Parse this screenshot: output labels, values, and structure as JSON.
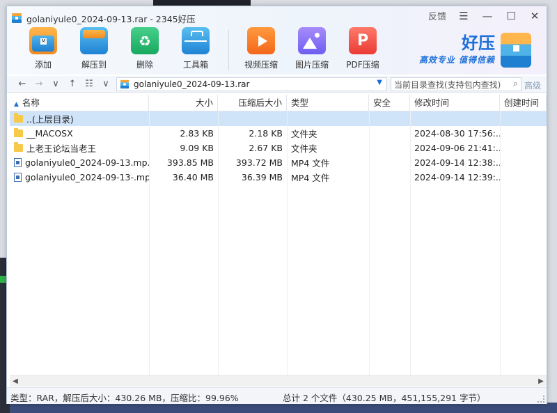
{
  "window": {
    "title": "golaniyule0_2024-09-13.rar - 2345好压",
    "feedback_label": "反馈",
    "menu_icon": "hamburger-icon",
    "minimize_icon": "minimize-icon",
    "maximize_icon": "maximize-icon",
    "close_icon": "close-icon"
  },
  "toolbar": {
    "items": [
      {
        "label": "添加",
        "icon": "add-archive-icon"
      },
      {
        "label": "解压到",
        "icon": "extract-icon"
      },
      {
        "label": "删除",
        "icon": "recycle-delete-icon"
      },
      {
        "label": "工具箱",
        "icon": "toolbox-icon"
      },
      {
        "label": "视频压缩",
        "icon": "video-compress-icon"
      },
      {
        "label": "图片压缩",
        "icon": "image-compress-icon"
      },
      {
        "label": "PDF压缩",
        "icon": "pdf-compress-icon"
      }
    ]
  },
  "brand": {
    "name": "好压",
    "slogan": "高效专业  值得信赖"
  },
  "address": {
    "path": "golaniyule0_2024-09-13.rar",
    "search_placeholder": "当前目录查找(支持包内查找)",
    "advanced_label": "高级"
  },
  "table": {
    "columns": [
      "名称",
      "大小",
      "压缩后大小",
      "类型",
      "安全",
      "修改时间",
      "创建时间"
    ],
    "rows": [
      {
        "name": "..(上层目录)",
        "size": "",
        "packed": "",
        "type": "",
        "security": "",
        "modified": "",
        "created": "",
        "kind": "folder",
        "selected": true
      },
      {
        "name": "__MACOSX",
        "size": "2.83 KB",
        "packed": "2.18 KB",
        "type": "文件夹",
        "security": "",
        "modified": "2024-08-30 17:56:...",
        "created": "",
        "kind": "folder",
        "selected": false
      },
      {
        "name": "上老王论坛当老王",
        "size": "9.09 KB",
        "packed": "2.67 KB",
        "type": "文件夹",
        "security": "",
        "modified": "2024-09-06 21:41:...",
        "created": "",
        "kind": "folder",
        "selected": false
      },
      {
        "name": "golaniyule0_2024-09-13.mp...",
        "size": "393.85 MB",
        "packed": "393.72 MB",
        "type": "MP4 文件",
        "security": "",
        "modified": "2024-09-14 12:38:...",
        "created": "",
        "kind": "mp4",
        "selected": false
      },
      {
        "name": "golaniyule0_2024-09-13-.mp...",
        "size": "36.40 MB",
        "packed": "36.39 MB",
        "type": "MP4 文件",
        "security": "",
        "modified": "2024-09-14 12:39:...",
        "created": "",
        "kind": "mp4",
        "selected": false
      }
    ]
  },
  "status": {
    "left": "类型：RAR，解压后大小：430.26 MB，压缩比：99.96%",
    "right": "总计 2 个文件（430.25 MB，451,155,291 字节）"
  }
}
